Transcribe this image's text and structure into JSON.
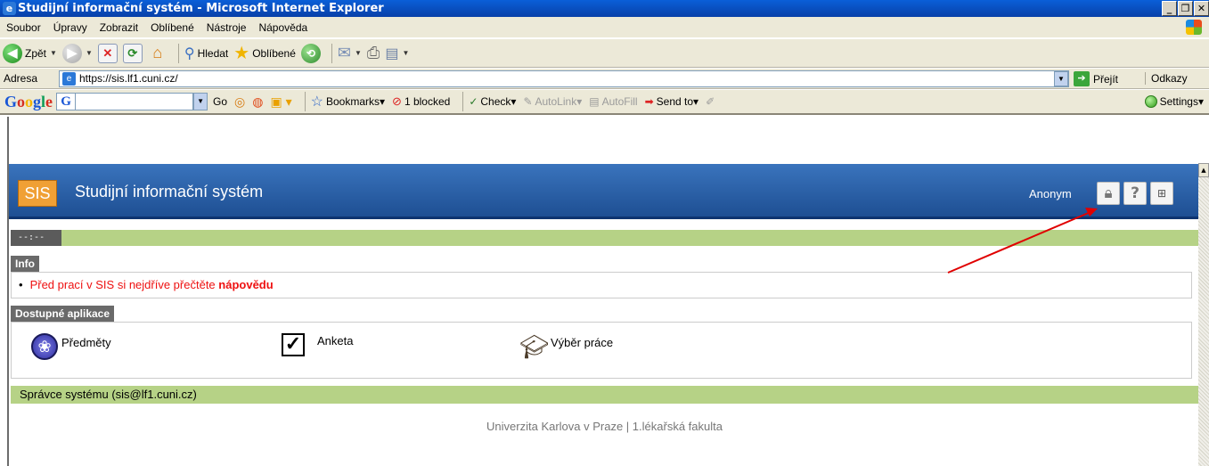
{
  "window": {
    "title": "Studijní informační systém - Microsoft Internet Explorer",
    "buttons": [
      "_",
      "❐",
      "✕"
    ]
  },
  "menu": [
    "Soubor",
    "Úpravy",
    "Zobrazit",
    "Oblíbené",
    "Nástroje",
    "Nápověda"
  ],
  "toolbar": {
    "back": "Zpět",
    "search": "Hledat",
    "favorites": "Oblíbené"
  },
  "address": {
    "label": "Adresa",
    "url": "https://sis.lf1.cuni.cz/",
    "go": "Přejít",
    "links": "Odkazy"
  },
  "google_bar": {
    "go": "Go",
    "bookmarks": "Bookmarks",
    "blocked": "1 blocked",
    "check": "Check",
    "autolink": "AutoLink",
    "autofill": "AutoFill",
    "send_to": "Send to",
    "settings": "Settings"
  },
  "sis": {
    "logo": "SIS",
    "title": "Studijní informační systém",
    "user": "Anonym",
    "time": "--:--",
    "info_header": "Info",
    "info_text": "Před prací v SIS si nejdříve přečtěte ",
    "info_link": "nápovědu",
    "apps_header": "Dostupné aplikace",
    "apps": [
      {
        "label": "Předměty",
        "icon": "knot-icon"
      },
      {
        "label": "Anketa",
        "icon": "checkbox-icon"
      },
      {
        "label": "Výběr práce",
        "icon": "graduation-cap-icon"
      }
    ],
    "admin": "Správce systému (sis@lf1.cuni.cz)",
    "footer": "Univerzita Karlova v Praze | 1.lékařská fakulta"
  },
  "colors": {
    "header_blue": "#2b62a8",
    "green_bar": "#b6d286",
    "info_red": "#e11111",
    "annotation_arrow": "#e00000"
  }
}
